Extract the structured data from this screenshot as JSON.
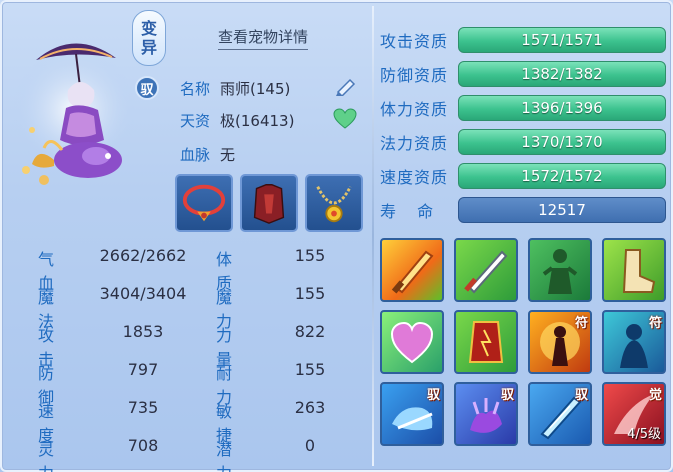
{
  "pet": {
    "mutation_label": [
      "变",
      "异"
    ],
    "yu_label": "驭",
    "view_details": "查看宠物详情",
    "name_label": "名称",
    "name_value": "雨师(145)",
    "aptitude_label": "天资",
    "aptitude_value": "极(16413)",
    "bloodline_label": "血脉",
    "bloodline_value": "无"
  },
  "stats": [
    {
      "label": "气血",
      "value": "2662/2662",
      "label2": "体质",
      "value2": "155"
    },
    {
      "label": "魔法",
      "value": "3404/3404",
      "label2": "魔力",
      "value2": "155"
    },
    {
      "label": "攻击",
      "value": "1853",
      "label2": "力量",
      "value2": "822"
    },
    {
      "label": "防御",
      "value": "797",
      "label2": "耐力",
      "value2": "155"
    },
    {
      "label": "速度",
      "value": "735",
      "label2": "敏捷",
      "value2": "263"
    },
    {
      "label": "灵力",
      "value": "708",
      "label2": "潜力",
      "value2": "0"
    }
  ],
  "aptitudes": [
    {
      "label": "攻击资质",
      "value": "1571/1571",
      "fill": 1.0
    },
    {
      "label": "防御资质",
      "value": "1382/1382",
      "fill": 1.0
    },
    {
      "label": "体力资质",
      "value": "1396/1396",
      "fill": 1.0
    },
    {
      "label": "法力资质",
      "value": "1370/1370",
      "fill": 1.0
    },
    {
      "label": "速度资质",
      "value": "1572/1572",
      "fill": 1.0
    }
  ],
  "lifespan": {
    "label": "寿 命",
    "value": "12517"
  },
  "skills": [
    {
      "name": "flaming-sword-skill-icon",
      "tag": ""
    },
    {
      "name": "sword-skill-icon",
      "tag": ""
    },
    {
      "name": "green-figure-skill-icon",
      "tag": ""
    },
    {
      "name": "boot-skill-icon",
      "tag": ""
    },
    {
      "name": "heart-skill-icon",
      "tag": ""
    },
    {
      "name": "shield-skill-icon",
      "tag": ""
    },
    {
      "name": "fire-warrior-skill-icon",
      "tag": "符"
    },
    {
      "name": "blue-spirit-skill-icon",
      "tag": "符"
    },
    {
      "name": "blue-beast-skill-icon",
      "tag": "驭"
    },
    {
      "name": "purple-claw-skill-icon",
      "tag": "驭"
    },
    {
      "name": "ice-blade-skill-icon",
      "tag": "驭"
    },
    {
      "name": "red-awaken-skill-icon",
      "tag": "觉",
      "level": "4/5级"
    }
  ],
  "colors": {
    "label_blue": "#1f6bc0",
    "bar_green": "#3cc28e",
    "bar_blue": "#3f6fb0"
  }
}
